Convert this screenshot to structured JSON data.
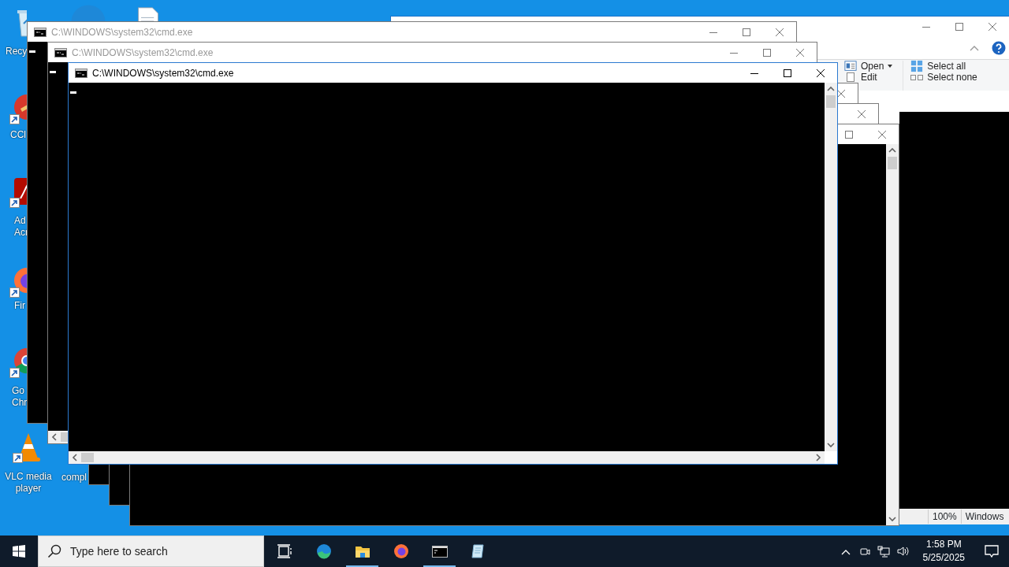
{
  "desktop_icons": [
    {
      "kind": "recycle-bin",
      "lines": [
        "Recy"
      ]
    },
    {
      "kind": "edge"
    },
    {
      "kind": "document"
    },
    {
      "kind": "ccleaner",
      "lines": [
        "CCl"
      ]
    },
    {
      "kind": "acrobat",
      "lines": [
        "Ad",
        "Acr"
      ]
    },
    {
      "kind": "firefox",
      "lines": [
        "Fir"
      ]
    },
    {
      "kind": "chrome",
      "lines": [
        "Go",
        "Chr"
      ]
    },
    {
      "kind": "vlc",
      "lines": [
        "VLC media",
        "player"
      ]
    },
    {
      "kind": "hidden",
      "lines": [
        "compl"
      ]
    }
  ],
  "explorer": {
    "ribbon": [
      {
        "kind": "open",
        "label": "Open",
        "dropdown": true
      },
      {
        "kind": "edit",
        "label": "Edit",
        "dropdown": false
      },
      {
        "kind": "select-all",
        "label": "Select all",
        "dropdown": false
      },
      {
        "kind": "select-none",
        "label": "Select none",
        "dropdown": false
      }
    ]
  },
  "notepad": {
    "status_bar": [
      "100%",
      "Windows"
    ]
  },
  "cmd_windows": [
    {
      "title": "C:\\WINDOWS\\system32\\cmd.exe",
      "active": false,
      "hscroll": false
    },
    {
      "title": "C:\\WINDOWS\\system32\\cmd.exe",
      "active": false,
      "hscroll": true
    },
    {
      "title": "C:\\WINDOWS\\system32\\cmd.exe",
      "active": true,
      "hscroll": true
    },
    {
      "active": false,
      "hscroll": false
    },
    {
      "active": false,
      "hscroll": false
    },
    {
      "active": false,
      "hscroll": false
    }
  ],
  "taskbar": {
    "search": {
      "placeholder": "Type here to search"
    },
    "apps": [
      {
        "kind": "task-view",
        "running": false
      },
      {
        "kind": "edge",
        "running": false
      },
      {
        "kind": "file-explorer",
        "running": true
      },
      {
        "kind": "firefox",
        "running": false
      },
      {
        "kind": "terminal",
        "running": true
      },
      {
        "kind": "notepad",
        "running": false
      }
    ],
    "clock": {
      "time": "1:58 PM",
      "date": "5/25/2025"
    }
  }
}
